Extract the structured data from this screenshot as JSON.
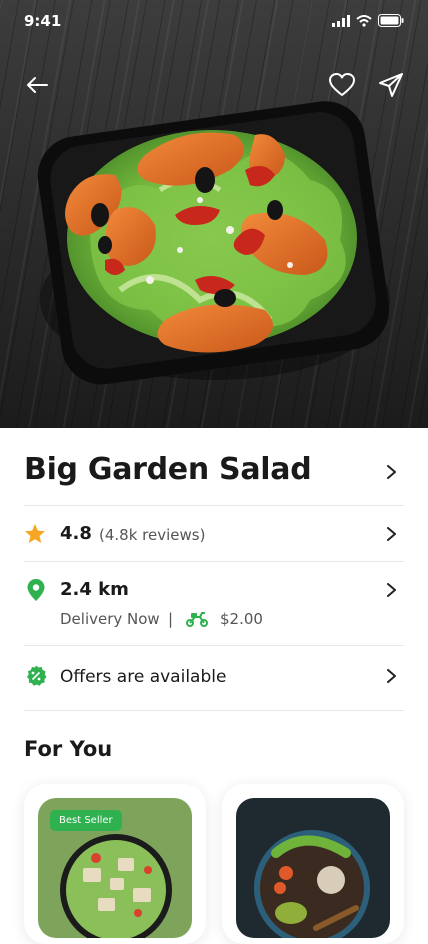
{
  "status_bar": {
    "time": "9:41"
  },
  "product": {
    "title": "Big Garden Salad",
    "rating": "4.8",
    "reviews": "(4.8k reviews)",
    "distance": "2.4 km",
    "delivery_text": "Delivery Now",
    "separator": "|",
    "delivery_fee": "$2.00",
    "offers_text": "Offers are available"
  },
  "section": {
    "for_you_title": "For You"
  },
  "cards": [
    {
      "badge": "Best Seller"
    },
    {
      "badge": ""
    }
  ],
  "colors": {
    "accent": "#2fb14f",
    "star": "#f5a623"
  }
}
